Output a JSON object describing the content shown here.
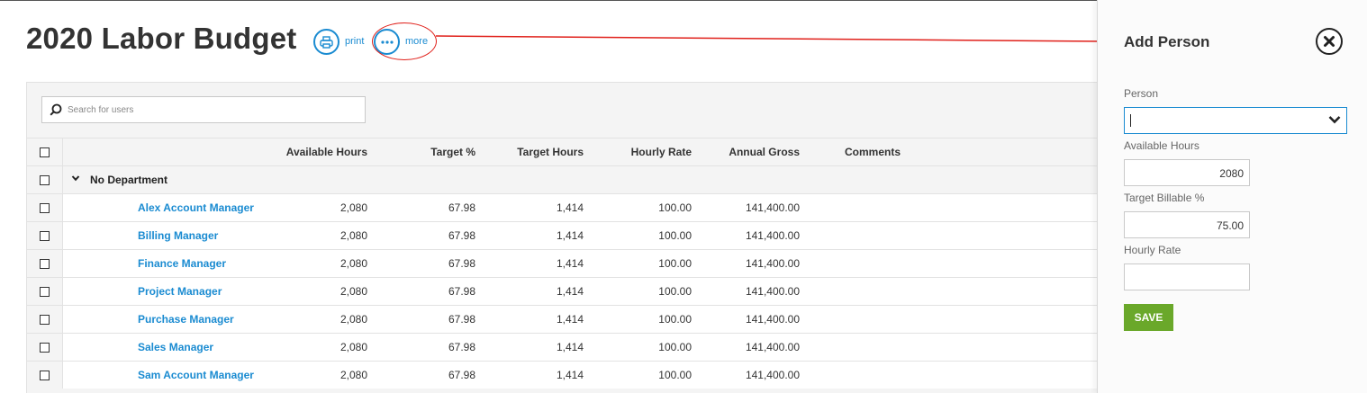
{
  "page": {
    "title": "2020 Labor Budget",
    "print_label": "print",
    "more_label": "more"
  },
  "search": {
    "placeholder": "Search for users"
  },
  "table": {
    "columns": [
      "Available Hours",
      "Target %",
      "Target Hours",
      "Hourly Rate",
      "Annual Gross",
      "Comments"
    ],
    "department": "No Department",
    "rows": [
      {
        "name": "Alex Account Manager",
        "available_hours": "2,080",
        "target_pct": "67.98",
        "target_hours": "1,414",
        "hourly_rate": "100.00",
        "annual_gross": "141,400.00",
        "comments": ""
      },
      {
        "name": "Billing Manager",
        "available_hours": "2,080",
        "target_pct": "67.98",
        "target_hours": "1,414",
        "hourly_rate": "100.00",
        "annual_gross": "141,400.00",
        "comments": ""
      },
      {
        "name": "Finance Manager",
        "available_hours": "2,080",
        "target_pct": "67.98",
        "target_hours": "1,414",
        "hourly_rate": "100.00",
        "annual_gross": "141,400.00",
        "comments": ""
      },
      {
        "name": "Project Manager",
        "available_hours": "2,080",
        "target_pct": "67.98",
        "target_hours": "1,414",
        "hourly_rate": "100.00",
        "annual_gross": "141,400.00",
        "comments": ""
      },
      {
        "name": "Purchase Manager",
        "available_hours": "2,080",
        "target_pct": "67.98",
        "target_hours": "1,414",
        "hourly_rate": "100.00",
        "annual_gross": "141,400.00",
        "comments": ""
      },
      {
        "name": "Sales Manager",
        "available_hours": "2,080",
        "target_pct": "67.98",
        "target_hours": "1,414",
        "hourly_rate": "100.00",
        "annual_gross": "141,400.00",
        "comments": ""
      },
      {
        "name": "Sam Account Manager",
        "available_hours": "2,080",
        "target_pct": "67.98",
        "target_hours": "1,414",
        "hourly_rate": "100.00",
        "annual_gross": "141,400.00",
        "comments": ""
      }
    ]
  },
  "side_panel": {
    "title": "Add Person",
    "person_label": "Person",
    "person_value": "",
    "available_hours_label": "Available Hours",
    "available_hours_value": "2080",
    "target_billable_label": "Target Billable %",
    "target_billable_value": "75.00",
    "hourly_rate_label": "Hourly Rate",
    "hourly_rate_value": "",
    "save_label": "SAVE"
  },
  "icons": {
    "print": "printer-icon",
    "more": "ellipsis-icon",
    "search": "search-icon",
    "caret": "chevron-down-icon",
    "close": "close-circle-icon"
  },
  "colors": {
    "accent": "#1a8bd1",
    "annotation": "#e0201a",
    "save": "#6aa82a"
  }
}
